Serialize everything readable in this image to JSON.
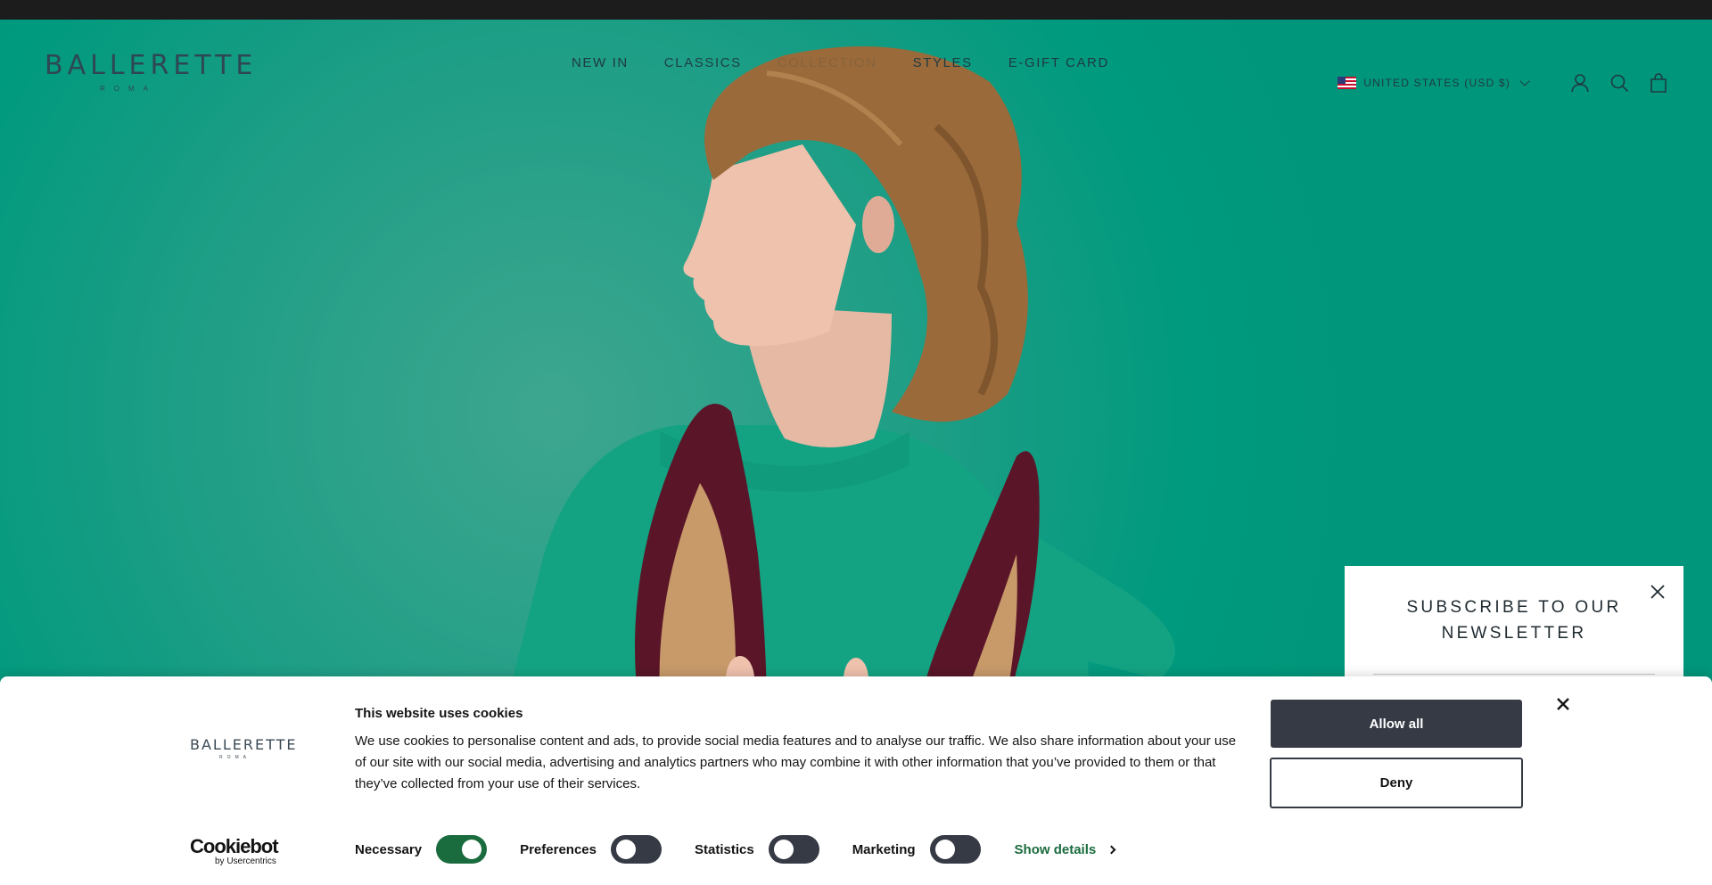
{
  "header": {
    "logo_text": "BALLERETTE",
    "logo_sub": "ROMA",
    "nav": [
      "NEW IN",
      "CLASSICS",
      "COLLECTION",
      "STYLES",
      "E-GIFT CARD"
    ],
    "locale": "UNITED STATES (USD $)",
    "icons": [
      "account-icon",
      "search-icon",
      "cart-icon"
    ]
  },
  "hero": {
    "background_color": "#009a7e",
    "image": "woman-holding-burgundy-pointed-flats"
  },
  "newsletter": {
    "title_line1": "SUBSCRIBE TO OUR",
    "title_line2": "NEWSLETTER"
  },
  "cookie": {
    "logo_text": "BALLERETTE",
    "logo_sub": "ROMA",
    "title": "This website uses cookies",
    "body": "We use cookies to personalise content and ads, to provide social media features and to analyse our traffic. We also share information about your use of our site with our social media, advertising and analytics partners who may combine it with other information that you’ve provided to them or that they’ve collected from your use of their services.",
    "allow_label": "Allow all",
    "deny_label": "Deny",
    "provider_word": "Cookiebot",
    "provider_sub": "by Usercentrics",
    "categories": [
      {
        "label": "Necessary",
        "enabled": true
      },
      {
        "label": "Preferences",
        "enabled": false
      },
      {
        "label": "Statistics",
        "enabled": false
      },
      {
        "label": "Marketing",
        "enabled": false
      }
    ],
    "show_details_label": "Show details",
    "accent_color": "#1a6b3e"
  }
}
